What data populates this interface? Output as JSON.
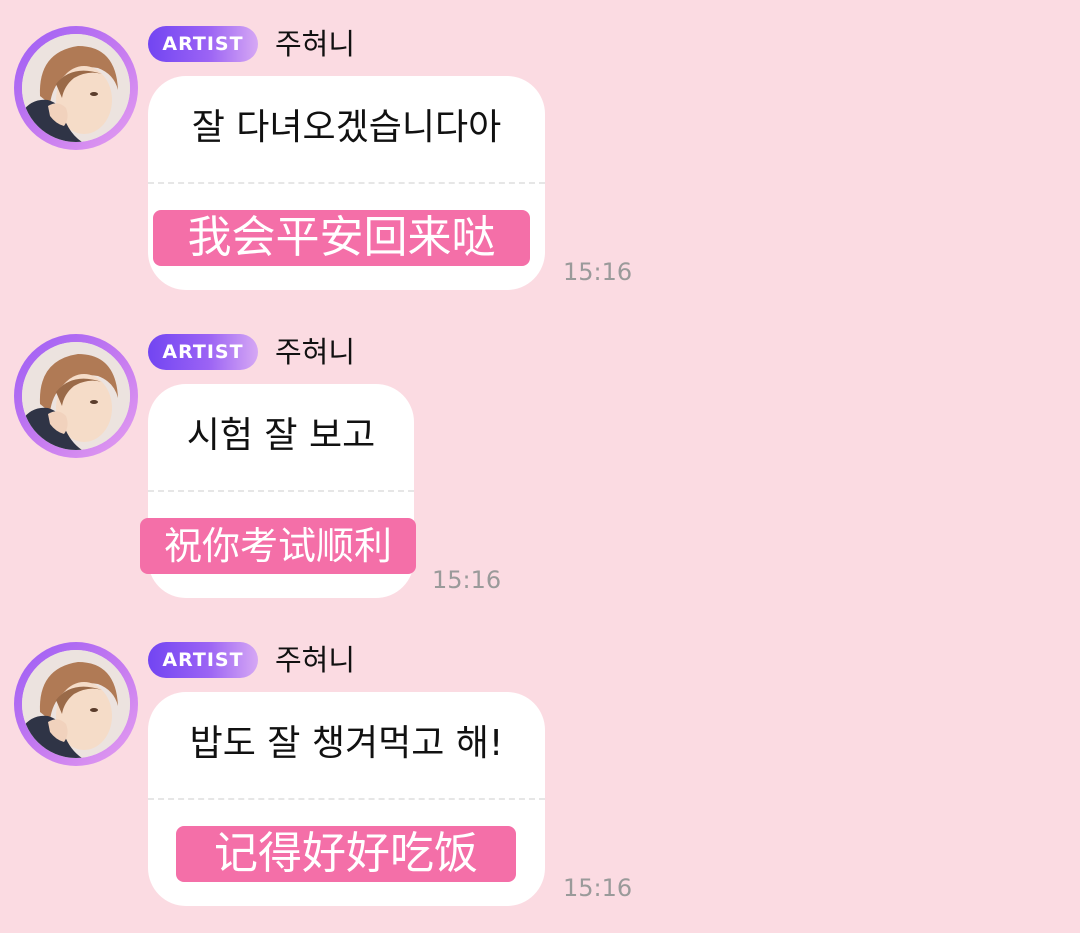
{
  "messages": [
    {
      "badge": "ARTIST",
      "sender": "주혀니",
      "text": "잘 다녀오겠습니다아",
      "translation": "我会平安回来哒",
      "time": "15:16"
    },
    {
      "badge": "ARTIST",
      "sender": "주혀니",
      "text": "시험 잘 보고",
      "translation": "祝你考试顺利",
      "time": "15:16"
    },
    {
      "badge": "ARTIST",
      "sender": "주혀니",
      "text": "밥도 잘 챙겨먹고 해!",
      "translation": "记得好好吃饭",
      "time": "15:16"
    }
  ],
  "colors": {
    "background": "#fbdbe2",
    "bubble": "#ffffff",
    "translation_highlight": "#f46fa8",
    "badge_start": "#7245f2",
    "badge_end": "#d6a8f4",
    "avatar_ring": "#9b5cf5",
    "timestamp": "#9a9a9a"
  },
  "icons": {
    "avatar": "profile-photo"
  }
}
